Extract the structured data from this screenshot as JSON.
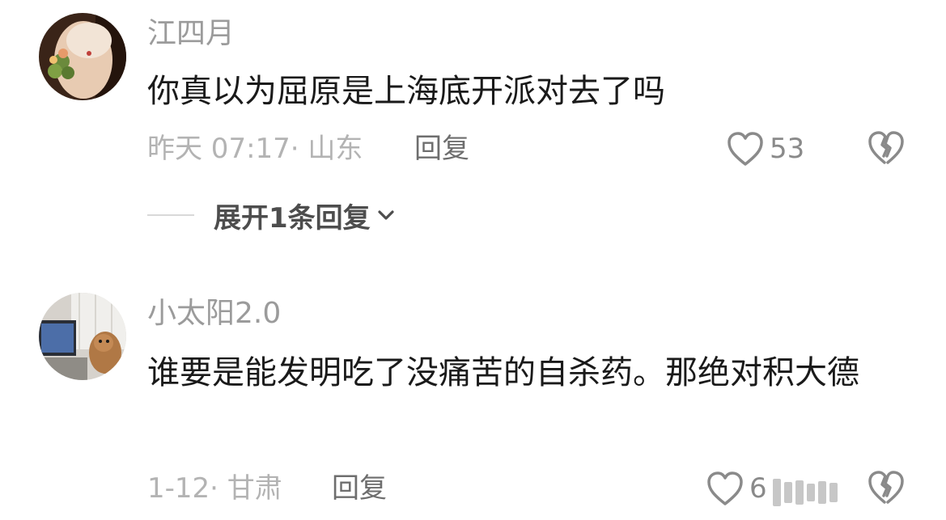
{
  "comments": [
    {
      "username": "江四月",
      "text": "你真以为屈原是上海底开派对去了吗",
      "time": "昨天 07:17",
      "location": "山东",
      "reply_label": "回复",
      "like_count": "53",
      "avatar_icon": "avatar-photo-woman-flowers",
      "expand_label": "展开1条回复"
    },
    {
      "username": "小太阳2.0",
      "text": "谁要是能发明吃了没痛苦的自杀药。那绝对积大德",
      "time": "1-12",
      "location": "甘肃",
      "reply_label": "回复",
      "like_count": "6",
      "avatar_icon": "avatar-photo-dog-computer"
    }
  ],
  "meta_separator": "·",
  "icons": {
    "like": "heart-outline-icon",
    "dislike": "broken-heart-icon",
    "expand": "chevron-down-icon"
  },
  "colors": {
    "text_primary": "#1a1a1a",
    "text_secondary": "#9b9b9b",
    "text_meta": "#b3b3b3",
    "background": "#ffffff"
  }
}
